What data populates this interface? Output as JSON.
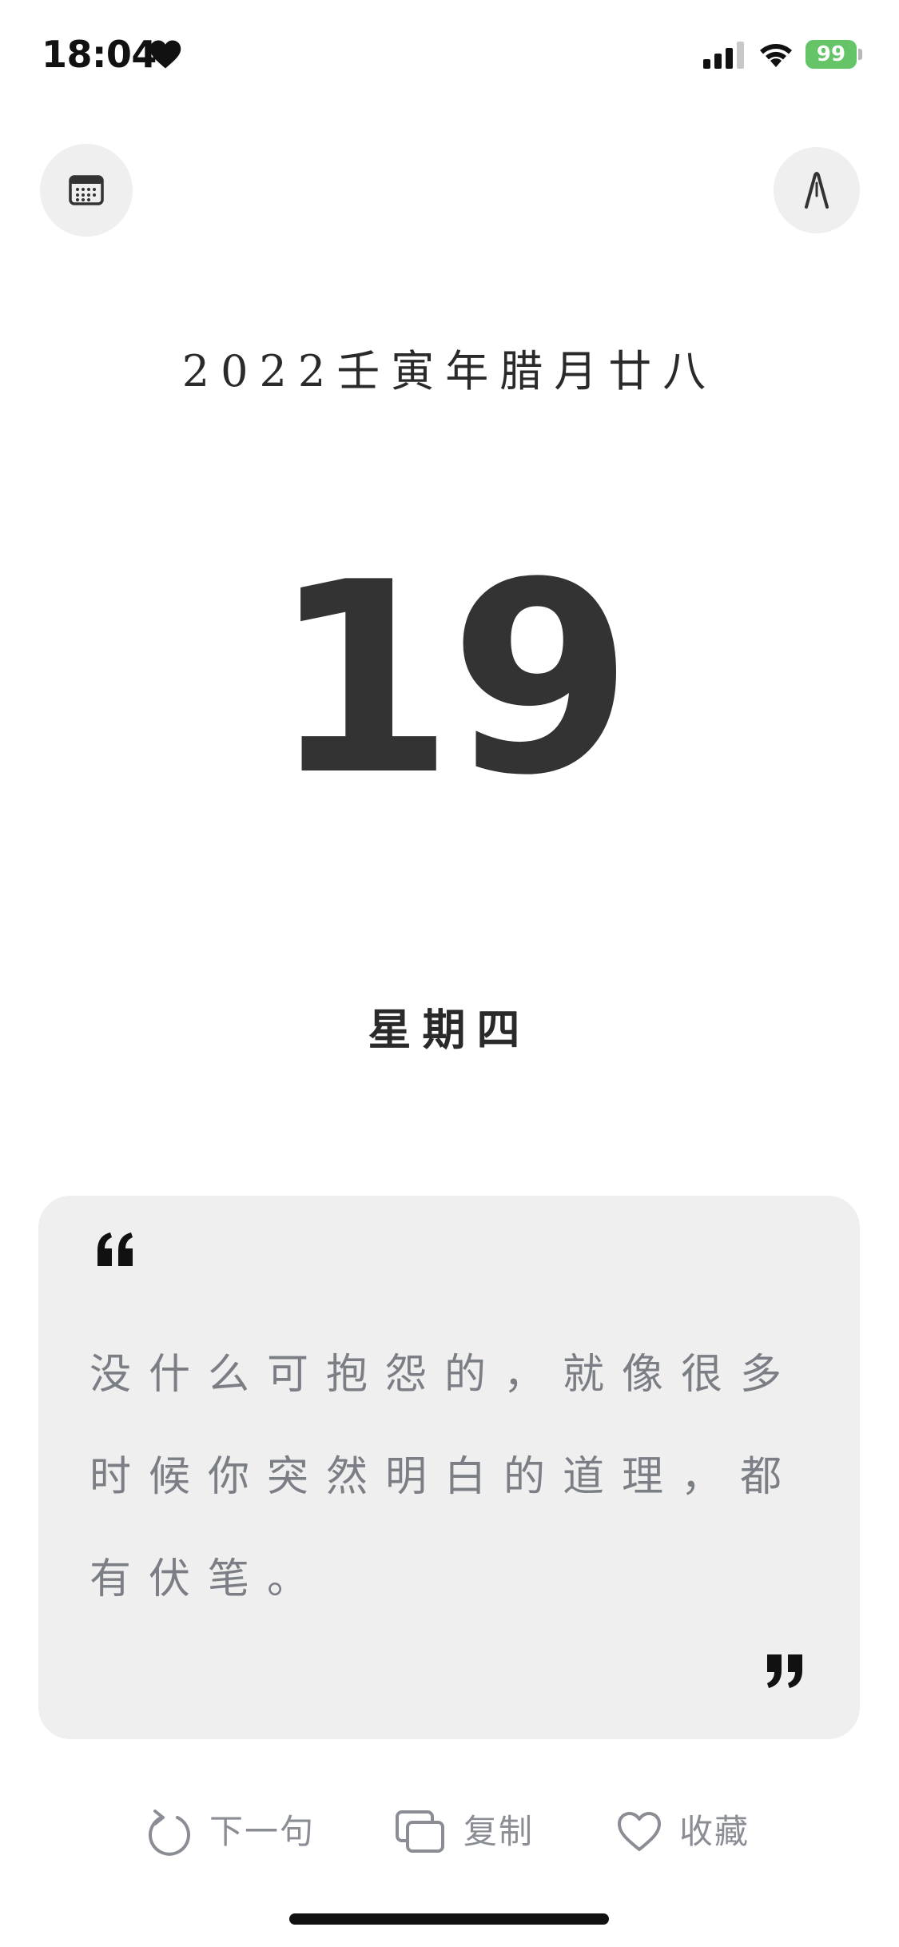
{
  "status_bar": {
    "time": "18:04",
    "battery": "99",
    "battery_color": "#65c466"
  },
  "icons": {
    "status": "heart-icon",
    "signal": "signal-icon",
    "wifi": "wifi-icon",
    "calendar": "calendar-icon",
    "font": "font-style-icon",
    "quote_open": "quote-open-icon",
    "quote_close": "quote-close-icon",
    "next": "refresh-icon",
    "copy": "copy-icon",
    "favorite": "heart-outline-icon"
  },
  "date": {
    "lunar": "2022壬寅年腊月廿八",
    "day": "19",
    "weekday": "星期四"
  },
  "quote": {
    "text": "没什么可抱怨的，就像很多时候你突然明白的道理，都有伏笔。"
  },
  "actions": {
    "next_label": "下一句",
    "copy_label": "复制",
    "favorite_label": "收藏"
  },
  "colors": {
    "card_background": "#efefef",
    "text_primary": "#333333",
    "text_muted": "#7b7f85"
  }
}
